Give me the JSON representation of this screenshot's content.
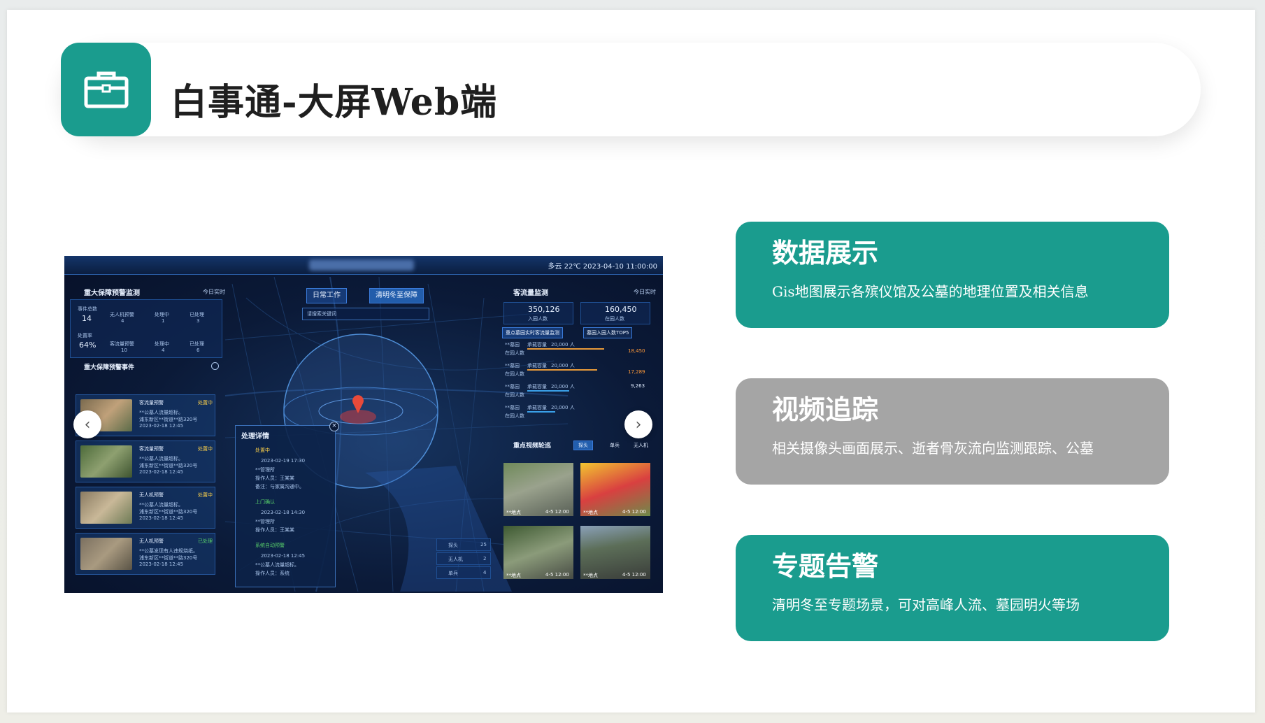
{
  "header": {
    "title": "白事通-大屏Web端",
    "icon": "briefcase-icon"
  },
  "cards": [
    {
      "title": "数据展示",
      "desc": "Gis地图展示各殡仪馆及公墓的地理位置及相关信息",
      "color": "#1a9c8e"
    },
    {
      "title": "视频追踪",
      "desc": "相关摄像头画面展示、逝者骨灰流向监测跟踪、公墓",
      "color": "#a5a5a5"
    },
    {
      "title": "专题告警",
      "desc": "清明冬至专题场景，可对高峰人流、墓园明火等场",
      "color": "#1a9c8e"
    }
  ],
  "dashboard": {
    "weather": "多云  22℃  2023-04-10  11:00:00",
    "left_panel": {
      "title": "重大保障预警监测",
      "sub": "今日实时",
      "stats_row1": [
        {
          "label": "事件总数",
          "value": "14"
        },
        {
          "label": "无人机预警",
          "value": "4"
        },
        {
          "label": "处理中",
          "value": "1"
        },
        {
          "label": "已处理",
          "value": "3"
        }
      ],
      "stats_row2": [
        {
          "label": "处置率",
          "value": "64%"
        },
        {
          "label": "客流量预警",
          "value": "10"
        },
        {
          "label": "处理中",
          "value": "4"
        },
        {
          "label": "已处理",
          "value": "6"
        }
      ],
      "events_title": "重大保障预警事件",
      "events": [
        {
          "type": "客流量预警",
          "status": "处置中",
          "line1": "**公墓人流量超标。",
          "line2": "浦东新区**街道**路320号",
          "time": "2023-02-18 12:45"
        },
        {
          "type": "客流量预警",
          "status": "处置中",
          "line1": "**公墓人流量超标。",
          "line2": "浦东新区**街道**路320号",
          "time": "2023-02-18 12:45"
        },
        {
          "type": "无人机预警",
          "status": "处置中",
          "line1": "**公墓人流量超标。",
          "line2": "浦东新区**街道**路320号",
          "time": "2023-02-18 12:45"
        },
        {
          "type": "无人机预警",
          "status": "已处理",
          "line1": "**公墓发现有人违规烧纸。",
          "line2": "浦东新区**街道**路320号",
          "time": "2023-02-18 12:45"
        }
      ]
    },
    "center": {
      "tab1": "日常工作",
      "tab2": "清明冬至保障",
      "search_placeholder": "请搜索关键词",
      "detail_title": "处理详情",
      "steps": [
        {
          "name": "处置中",
          "time": "2023-02-19 17:30",
          "l1": "**管理所",
          "l2": "操作人员：王某某",
          "l3": "备注：与家属沟通中。"
        },
        {
          "name": "上门确认",
          "time": "2023-02-18 14:30",
          "l1": "**管理所",
          "l2": "操作人员：王某某",
          "l3": ""
        },
        {
          "name": "系统自动预警",
          "time": "2023-02-18 12:45",
          "l1": "**公墓人流量超标。",
          "l2": "操作人员：系统",
          "l3": ""
        }
      ],
      "legend": [
        {
          "label": "探头",
          "value": "25"
        },
        {
          "label": "无人机",
          "value": "2"
        },
        {
          "label": "单兵",
          "value": "4"
        }
      ]
    },
    "right_panel": {
      "title": "客流量监测",
      "sub": "今日实时",
      "in_value": "350,126",
      "in_label": "入园人数",
      "cur_value": "160,450",
      "cur_label": "在园人数",
      "tab_a": "重点墓园实时客流量监测",
      "tab_b": "墓园入园人数TOP5",
      "rows": [
        {
          "name": "**墓园",
          "cap": "承载容量",
          "capv": "20,000 人",
          "sub": "在园人数",
          "val": "18,450",
          "warn": true
        },
        {
          "name": "**墓园",
          "cap": "承载容量",
          "capv": "20,000 人",
          "sub": "在园人数",
          "val": "17,289",
          "warn": true
        },
        {
          "name": "**墓园",
          "cap": "承载容量",
          "capv": "20,000 人",
          "sub": "在园人数",
          "val": "9,263",
          "warn": false
        },
        {
          "name": "**墓园",
          "cap": "承载容量",
          "capv": "20,000 人",
          "sub": "在园人数",
          "val": "",
          "warn": false
        }
      ],
      "video_title": "重点视频轮巡",
      "video_tabs": [
        "探头",
        "单兵",
        "无人机"
      ],
      "cams": [
        {
          "place": "**地点",
          "time": "4-5 12:00"
        },
        {
          "place": "**地点",
          "time": "4-5 12:00"
        },
        {
          "place": "**地点",
          "time": "4-5 12:00"
        },
        {
          "place": "**地点",
          "time": "4-5 12:00"
        }
      ]
    }
  }
}
